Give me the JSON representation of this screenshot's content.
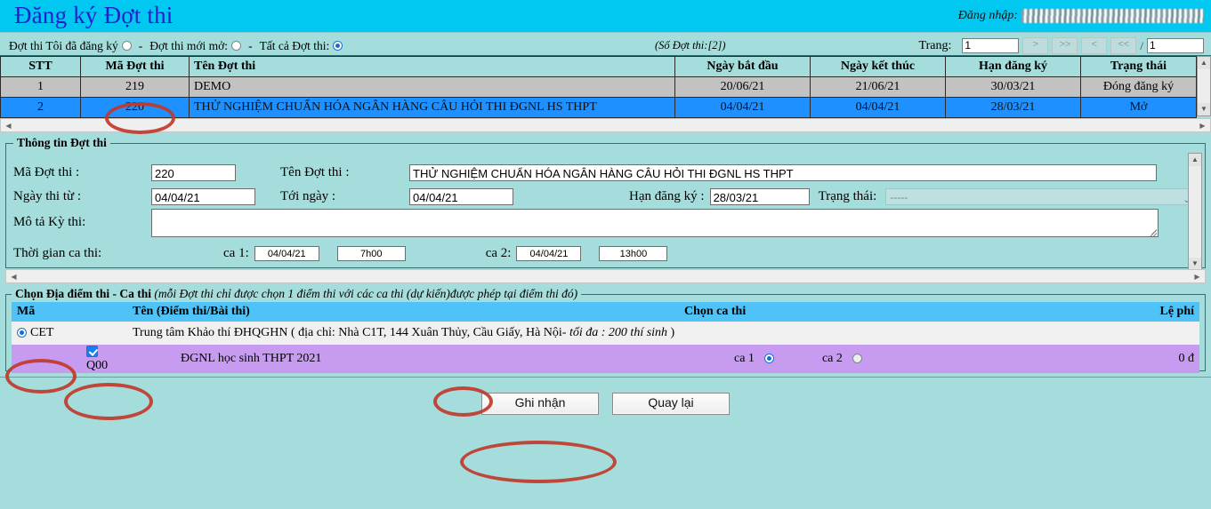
{
  "header": {
    "title": "Đăng ký Đợt thi",
    "login_label": "Đăng nhập:",
    "login_value_redacted": ""
  },
  "filter": {
    "option_registered": "Đợt thi Tôi đã đăng ký",
    "sep1": "-",
    "option_new": "Đợt thi mới mở:",
    "sep2": "-",
    "option_all": "Tất cả Đợt thi:",
    "selected": "Tất cả Đợt thi",
    "count_note": "(Số Đợt thi:[2])"
  },
  "paging": {
    "label": "Trang:",
    "current_page": "1",
    "btn_next": ">",
    "btn_last": ">>",
    "btn_prev": "<",
    "btn_first": "<<",
    "slash": "/",
    "total_pages": "1"
  },
  "grid": {
    "columns": [
      "STT",
      "Mã Đợt thi",
      "Tên Đợt thi",
      "Ngày bắt đầu",
      "Ngày kết thúc",
      "Hạn đăng ký",
      "Trạng thái"
    ],
    "rows": [
      {
        "stt": "1",
        "ma": "219",
        "ten": "DEMO",
        "bat_dau": "20/06/21",
        "ket_thuc": "21/06/21",
        "han": "30/03/21",
        "trang_thai": "Đóng đăng ký"
      },
      {
        "stt": "2",
        "ma": "220",
        "ten": "THỬ NGHIỆM CHUẨN HÓA NGÂN HÀNG CÂU HỎI THI ĐGNL HS THPT",
        "bat_dau": "04/04/21",
        "ket_thuc": "04/04/21",
        "han": "28/03/21",
        "trang_thai": "Mở"
      }
    ]
  },
  "info": {
    "legend": "Thông tin Đợt thi",
    "ma_label": "Mã Đợt thi :",
    "ma_value": "220",
    "ten_label": "Tên Đợt thi :",
    "ten_value": "THỬ NGHIỆM CHUẨN HÓA NGÂN HÀNG CÂU HỎI THI ĐGNL HS THPT",
    "ngay_tu_label": "Ngày thi từ :",
    "ngay_tu_value": "04/04/21",
    "toi_ngay_label": "Tới ngày :",
    "toi_ngay_value": "04/04/21",
    "han_label": "Hạn đăng ký :",
    "han_value": "28/03/21",
    "trang_thai_label": "Trạng thái:",
    "trang_thai_value": "-----",
    "mota_label": "Mô tả Kỳ thi:",
    "mota_value": "",
    "thoigian_label": "Thời gian ca thi:",
    "ca1_label": "ca 1:",
    "ca1_date": "04/04/21",
    "ca1_time": "7h00",
    "ca2_label": "ca 2:",
    "ca2_date": "04/04/21",
    "ca2_time": "13h00"
  },
  "venue": {
    "legend_bold": "Chọn Địa điểm thi - Ca thi ",
    "legend_italic": "(mỗi Đợt thi chỉ được chọn 1 điểm thi với các ca thi (dự kiến)được phép tại điểm thi đó)",
    "columns": {
      "ma": "Mã",
      "ten": "Tên (Điểm thi/Bài thi)",
      "chon_ca": "Chọn ca thi",
      "le_phi": "Lệ phí"
    },
    "site": {
      "code": "CET",
      "selected": true,
      "name_plain": "Trung tâm Khảo thí ĐHQGHN ( địa chỉ: Nhà C1T, 144 Xuân Thủy, Cầu Giấy, Hà Nội- ",
      "name_italic": "tối đa : 200 thí sinh",
      "name_tail": " )"
    },
    "exam": {
      "code": "Q00",
      "checked": true,
      "name": "ĐGNL học sinh THPT 2021",
      "ca1_label": "ca 1",
      "ca1_selected": true,
      "ca2_label": "ca 2",
      "ca2_selected": false,
      "fee": "0 đ"
    }
  },
  "buttons": {
    "save": "Ghi nhận",
    "back": "Quay lại"
  },
  "colors": {
    "title_bar": "#00C8F0",
    "title_text": "#2222CC",
    "page_bg": "#A5DCDC",
    "selected_row": "#1E90FF",
    "demo_row": "#C2C2C2",
    "venue_header": "#4FC3F7",
    "exam_row": "#C79BF0",
    "annotation": "#C0392B"
  }
}
